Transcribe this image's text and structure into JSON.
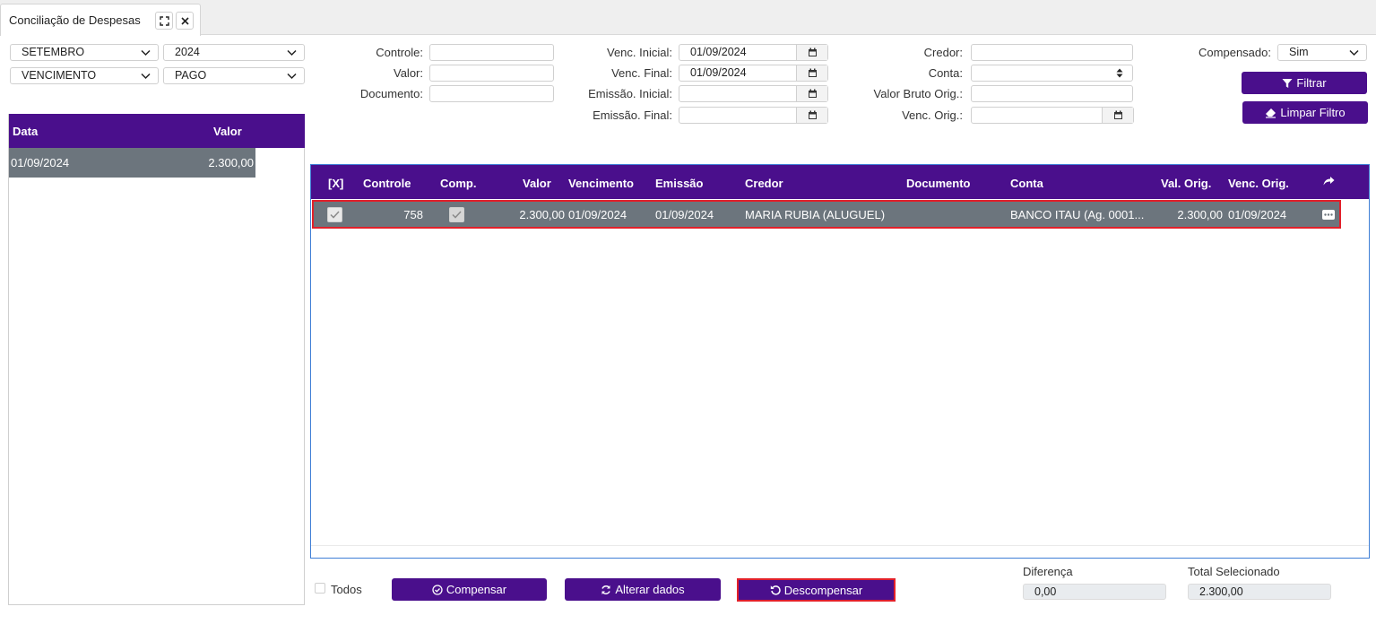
{
  "tab": {
    "title": "Conciliação de Despesas",
    "expand_icon": "expand-icon",
    "close_icon": "close-icon"
  },
  "left_filters": {
    "month": "SETEMBRO",
    "year": "2024",
    "date_type": "VENCIMENTO",
    "status": "PAGO"
  },
  "fields": {
    "controle": {
      "label": "Controle:",
      "value": ""
    },
    "valor": {
      "label": "Valor:",
      "value": ""
    },
    "documento": {
      "label": "Documento:",
      "value": ""
    },
    "venc_inicial": {
      "label": "Venc. Inicial:",
      "value": "01/09/2024"
    },
    "venc_final": {
      "label": "Venc. Final:",
      "value": "01/09/2024"
    },
    "emissao_inicial": {
      "label": "Emissão. Inicial:",
      "value": ""
    },
    "emissao_final": {
      "label": "Emissão. Final:",
      "value": ""
    },
    "credor": {
      "label": "Credor:",
      "value": ""
    },
    "conta": {
      "label": "Conta:",
      "value": ""
    },
    "valor_bruto": {
      "label": "Valor Bruto Orig.:",
      "value": ""
    },
    "venc_orig": {
      "label": "Venc. Orig.:",
      "value": ""
    },
    "compensado": {
      "label": "Compensado:",
      "value": "Sim"
    }
  },
  "buttons": {
    "filtrar": "Filtrar",
    "limpar": "Limpar Filtro",
    "compensar": "Compensar",
    "alterar": "Alterar dados",
    "descompensar": "Descompensar"
  },
  "left_table": {
    "headers": {
      "data": "Data",
      "valor": "Valor"
    },
    "rows": [
      {
        "data": "01/09/2024",
        "valor": "2.300,00"
      }
    ]
  },
  "main_table": {
    "headers": {
      "x": "[X]",
      "controle": "Controle",
      "comp": "Comp.",
      "valor": "Valor",
      "vencimento": "Vencimento",
      "emissao": "Emissão",
      "credor": "Credor",
      "documento": "Documento",
      "conta": "Conta",
      "val_orig": "Val. Orig.",
      "venc_orig": "Venc. Orig."
    },
    "rows": [
      {
        "controle": "758",
        "valor": "2.300,00",
        "vencimento": "01/09/2024",
        "emissao": "01/09/2024",
        "credor": "MARIA RUBIA (ALUGUEL)",
        "documento": "",
        "conta": "BANCO ITAU (Ag. 0001...",
        "val_orig": "2.300,00",
        "venc_orig": "01/09/2024"
      }
    ]
  },
  "footer": {
    "todos_label": "Todos",
    "diferenca_label": "Diferença",
    "diferenca_value": "0,00",
    "total_label": "Total Selecionado",
    "total_value": "2.300,00"
  },
  "colors": {
    "primary": "#4a0f8c",
    "row_selected": "#6c757d",
    "highlight": "#e2202a"
  }
}
